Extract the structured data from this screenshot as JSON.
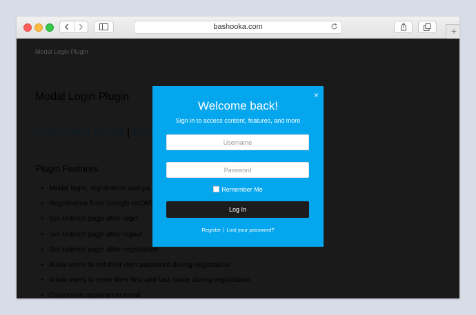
{
  "browser": {
    "address": "bashooka.com",
    "icons": {
      "back": "chevron-left-icon",
      "forward": "chevron-right-icon",
      "sidebar": "sidebar-icon",
      "reload": "reload-icon",
      "share": "share-icon",
      "tabs": "tabs-icon",
      "new_tab": "plus-icon"
    },
    "new_tab_glyph": "+"
  },
  "page": {
    "site_title": "Modal Login Plugin",
    "heading": "Modal Login Plugin",
    "links": {
      "login_demo": "Login Form Demo",
      "separator": "|",
      "register_demo": "Reg"
    },
    "features_heading": "Plugin Features",
    "features": [
      "Modal login, registration and pa",
      "Registration form Google reCAP",
      "Set redirect page after login",
      "Set redirect page after logout",
      "Set redirect page after registration",
      "Allow users to set their own password during registration",
      "Allow users to enter their first and last name during registration",
      "Customise registration email"
    ]
  },
  "modal": {
    "close_glyph": "×",
    "title": "Welcome back!",
    "subtitle": "Sign in to access content, features, and more",
    "username_placeholder": "Username",
    "password_placeholder": "Password",
    "remember_label": "Remember Me",
    "login_button": "Log In",
    "register_link": "Register",
    "links_separator": "|",
    "lost_password_link": "Lost your password?",
    "accent_color": "#04a6ee",
    "button_color": "#1c1c1c"
  }
}
